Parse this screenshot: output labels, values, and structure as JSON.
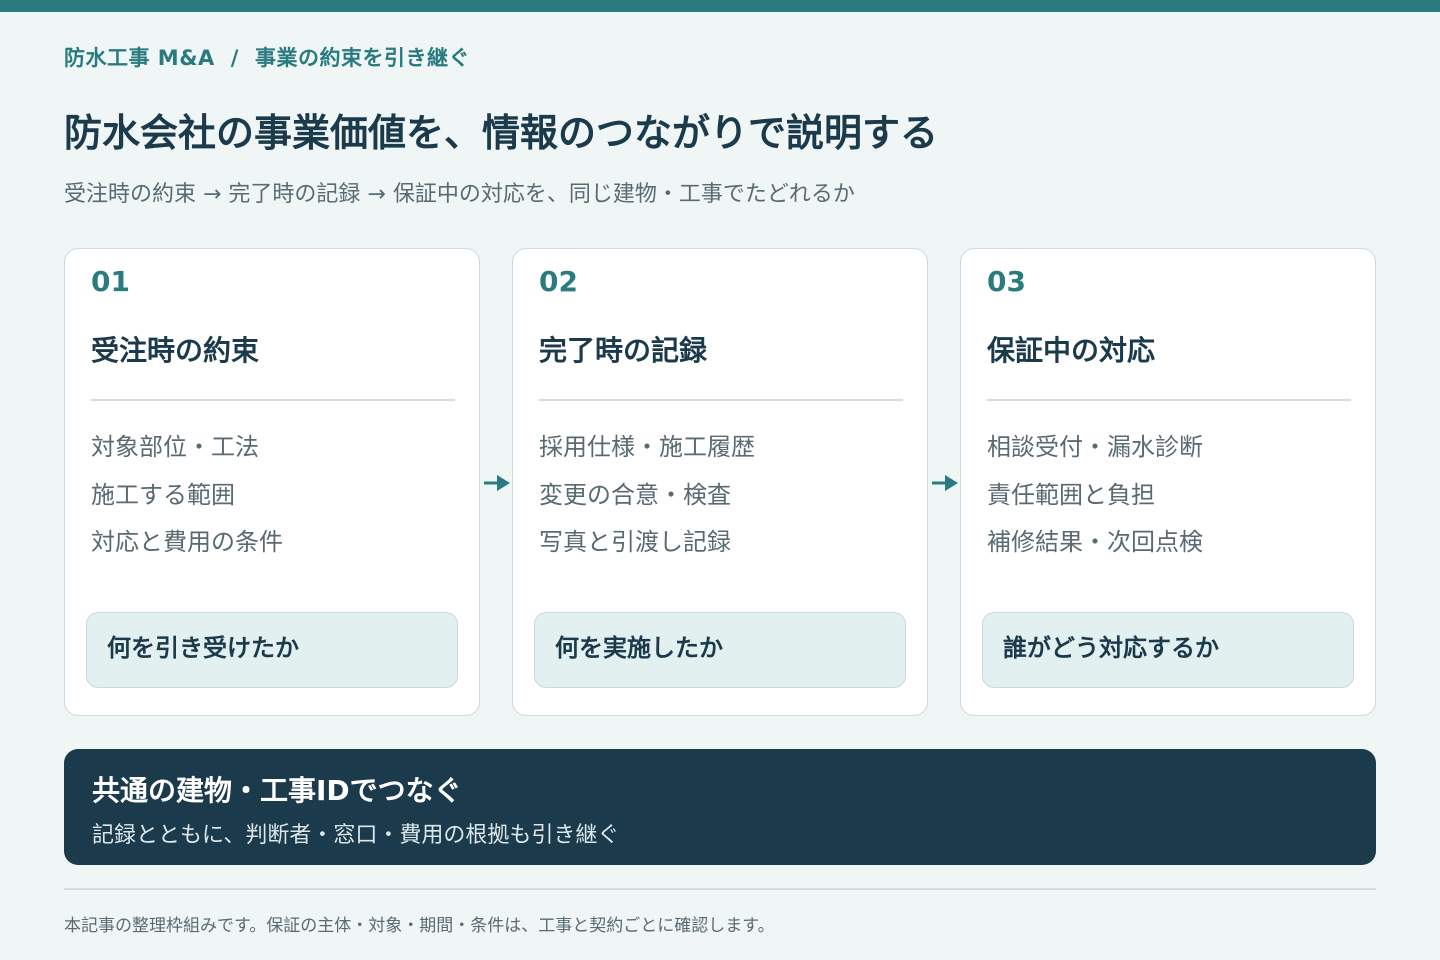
{
  "breadcrumb": {
    "section": "防水工事 M&A",
    "separator": "/",
    "topic": "事業の約束を引き継ぐ"
  },
  "title": "防水会社の事業価値を、情報のつながりで説明する",
  "subtitle": "受注時の約束 → 完了時の記録 → 保証中の対応を、同じ建物・工事でたどれるか",
  "steps": [
    {
      "num": "01",
      "title": "受注時の約束",
      "items": [
        "対象部位・工法",
        "施工する範囲",
        "対応と費用の条件"
      ],
      "tag": "何を引き受けたか"
    },
    {
      "num": "02",
      "title": "完了時の記録",
      "items": [
        "採用仕様・施工履歴",
        "変更の合意・検査",
        "写真と引渡し記録"
      ],
      "tag": "何を実施したか"
    },
    {
      "num": "03",
      "title": "保証中の対応",
      "items": [
        "相談受付・漏水診断",
        "責任範囲と負担",
        "補修結果・次回点検"
      ],
      "tag": "誰がどう対応するか"
    }
  ],
  "banner": {
    "title": "共通の建物・工事IDでつなぐ",
    "text": "記録とともに、判断者・窓口・費用の根拠も引き継ぐ"
  },
  "footnote": "本記事の整理枠組みです。保証の主体・対象・期間・条件は、工事と契約ごとに確認します。",
  "colors": {
    "accent": "#2a7b80",
    "navy": "#1b3a4b",
    "background": "#eff6f5"
  }
}
